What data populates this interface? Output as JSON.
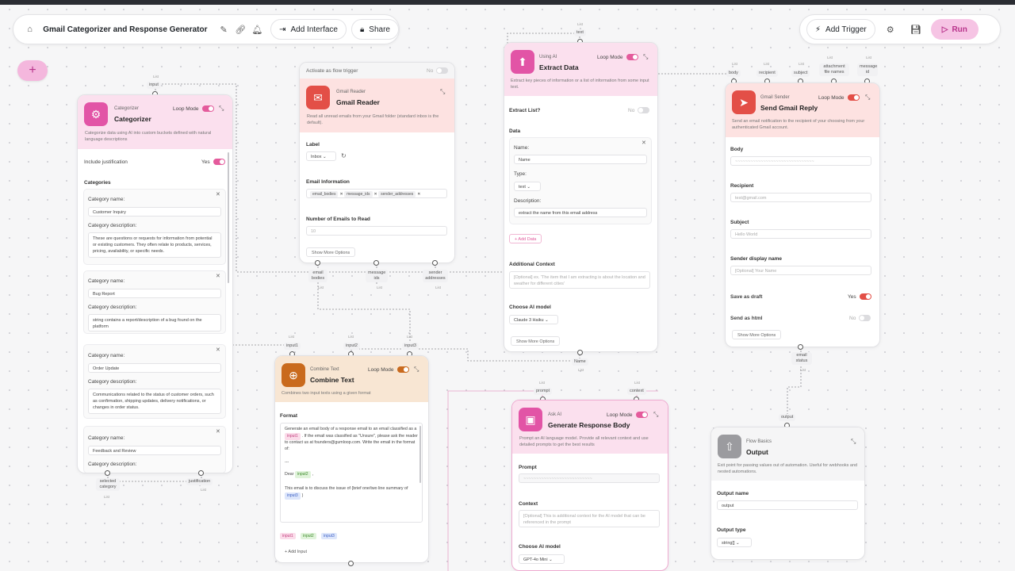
{
  "header": {
    "title": "Gmail Categorizer and Response Generator",
    "add_interface": "Add Interface",
    "share": "Share",
    "add_trigger": "Add Trigger",
    "run": "Run"
  },
  "common": {
    "loop_mode": "Loop Mode",
    "show_more": "Show More Options",
    "list": "List",
    "yes": "Yes",
    "no": "No"
  },
  "categorizer": {
    "category": "Categorizer",
    "title": "Categorizer",
    "description": "Categorize data using AI into custom buckets defined with natural language descriptions",
    "input_handle": "input",
    "include_justification": "Include justification",
    "categories_label": "Categories",
    "category_name_label": "Category name:",
    "category_desc_label": "Category description:",
    "items": [
      {
        "name": "Customer Inquiry",
        "description": "These are questions or requests for information from potential or existing customers. They often relate to products, services, pricing, availability, or specific needs."
      },
      {
        "name": "Bug Report",
        "description": "string contains a report/description of a bug found on the platform"
      },
      {
        "name": "Order Update",
        "description": "Communications related to the status of customer orders, such as confirmation, shipping updates, delivery notifications, or changes in order status."
      },
      {
        "name": "Feedback and Review",
        "description": ""
      }
    ],
    "out_selected": "selected category",
    "out_justification": "justification"
  },
  "gmail_reader": {
    "trigger_label": "Activate as flow trigger",
    "trigger_value": "No",
    "category": "Gmail Reader",
    "title": "Gmail Reader",
    "description": "Read all unread emails from your Gmail folder (standard inbox is the default).",
    "label_label": "Label",
    "label_value": "Inbox",
    "email_info_label": "Email Information",
    "email_info_chips": [
      "email_bodies",
      "message_ids",
      "sender_addresses"
    ],
    "num_label": "Number of Emails to Read",
    "num_placeholder": "10",
    "out_bodies": "email bodies",
    "out_ids": "message ids",
    "out_senders": "sender addresses"
  },
  "extract": {
    "text_handle": "text",
    "category": "Using AI",
    "title": "Extract Data",
    "description": "Extract key pieces of information or a list of information from some input text.",
    "extract_list_label": "Extract List?",
    "extract_list_value": "No",
    "data_label": "Data",
    "name_label": "Name:",
    "name_value": "Name",
    "type_label": "Type:",
    "type_value": "text",
    "desc_label": "Description:",
    "desc_value": "extract the name from this email address",
    "add_data": "+ Add Data",
    "context_label": "Additional Context",
    "context_placeholder": "[Optional] ex. 'The item that I am extracting is about the location and weather for different cities'",
    "model_label": "Choose AI model",
    "model_value": "Claude 3 Haiku",
    "out_name": "Name"
  },
  "gmail_sender": {
    "inputs": [
      "body",
      "recipient",
      "subject",
      "attachment file names",
      "message id"
    ],
    "category": "Gmail Sender",
    "title": "Send Gmail Reply",
    "description": "Send an email notification to the recipient of your choosing from your authenticated Gmail account.",
    "body_label": "Body",
    "body_value": "~~~~~~~~~~~~~~~~~~~~~~~~~~~~~~~",
    "recipient_label": "Recipient",
    "recipient_placeholder": "test@gmail.com",
    "subject_label": "Subject",
    "subject_placeholder": "Hello World",
    "sender_label": "Sender display name",
    "sender_placeholder": "[Optional] Your Name",
    "draft_label": "Save as draft",
    "draft_value": "Yes",
    "html_label": "Send as html",
    "html_value": "No",
    "out_status": "email status"
  },
  "combine": {
    "inputs": [
      "input1",
      "input2",
      "input3"
    ],
    "category": "Combine Text",
    "title": "Combine Text",
    "description": "Combines two input texts using a given format",
    "format_label": "Format",
    "format_p1": "Generate an email body of a response email to an email classified as a",
    "chip1": "input1",
    "format_p2": ". If the email was classified as \"Unsure\", please ask the reader to contact us at founders@gumloop.com. Write the email in the format of:",
    "format_dashes": "---",
    "dear": "Dear",
    "chip2": "input2",
    "format_p3": "This email is to discuss the issue of {brief one/two line summary of",
    "chip3": "input3",
    "chips": [
      "input1",
      "input2",
      "input3"
    ],
    "add_input": "+ Add Input"
  },
  "ask_ai": {
    "inputs": [
      "prompt",
      "context"
    ],
    "category": "Ask AI",
    "title": "Generate Response Body",
    "description": "Prompt an AI language model. Provide all relevant context and use detailed prompts to get the best results",
    "prompt_label": "Prompt",
    "prompt_value": "~~~~~~~~~~~~~~~~~~~~~~~~~~~",
    "context_label": "Context",
    "context_placeholder": "[Optional] This is additional context for the AI model that can be referenced in the prompt",
    "model_label": "Choose AI model",
    "model_value": "GPT-4o Mini"
  },
  "output": {
    "input_handle": "output",
    "category": "Flow Basics",
    "title": "Output",
    "description": "Exit point for passing values out of automation. Useful for webhooks and nested automations.",
    "name_label": "Output name",
    "name_value": "output",
    "type_label": "Output type",
    "type_value": "string[]"
  }
}
